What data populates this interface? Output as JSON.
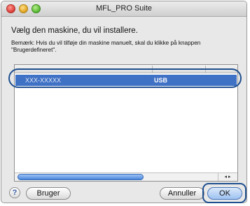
{
  "window": {
    "title": "MFL_PRO Suite"
  },
  "heading": "Vælg den maskine, du vil installere.",
  "note": "Bemærk: Hvis du vil tilføje din maskine manuelt, skal du klikke på knappen \"Brugerdefineret\".",
  "device_list": {
    "rows": [
      {
        "name": "XXX-XXXXX",
        "connection": "USB",
        "selected": true
      }
    ],
    "scroll_arrows": "◂ ▸"
  },
  "buttons": {
    "help": "?",
    "custom": "Bruger",
    "cancel": "Annuller",
    "ok": "OK"
  },
  "colors": {
    "selection": "#3f71c5",
    "highlight_ring": "#1f4f8f"
  }
}
